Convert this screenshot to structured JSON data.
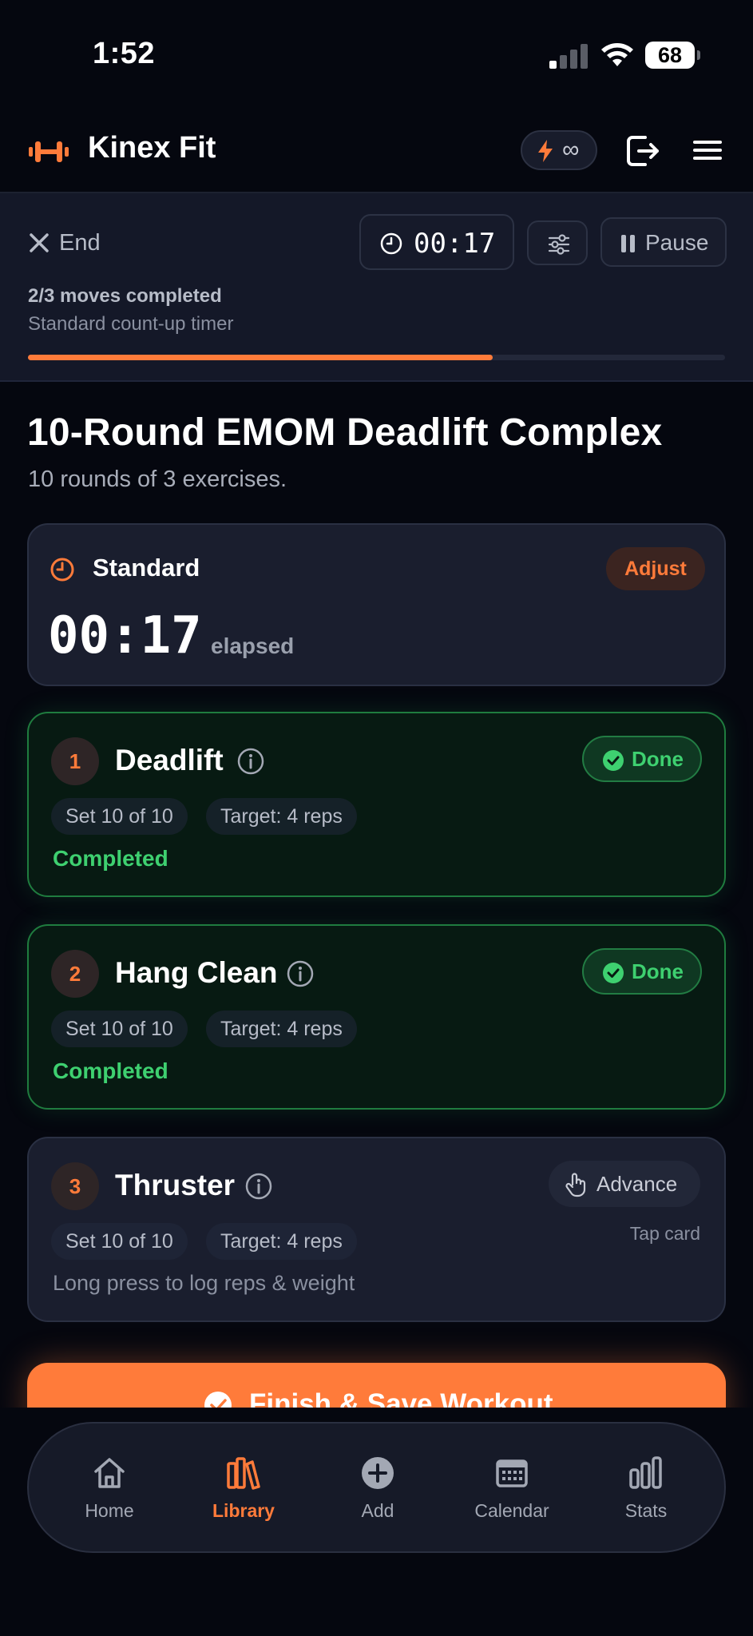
{
  "status_bar": {
    "time": "1:52",
    "battery": "68"
  },
  "header": {
    "app_name": "Kinex Fit",
    "energy": "∞"
  },
  "session": {
    "end_label": "End",
    "timer": "00:17",
    "pause_label": "Pause",
    "progress_text": "2/3 moves completed",
    "timer_mode_text": "Standard count-up timer",
    "progress_fraction": 0.667
  },
  "workout": {
    "title": "10-Round EMOM Deadlift Complex",
    "subtitle": "10 rounds of 3 exercises."
  },
  "timer_card": {
    "mode": "Standard",
    "adjust_label": "Adjust",
    "time": "00:17",
    "elapsed_label": "elapsed"
  },
  "exercises": [
    {
      "number": "1",
      "name": "Deadlift",
      "set": "Set 10 of 10",
      "target": "Target: 4 reps",
      "badge": "Done",
      "status": "Completed"
    },
    {
      "number": "2",
      "name": "Hang Clean",
      "set": "Set 10 of 10",
      "target": "Target: 4 reps",
      "badge": "Done",
      "status": "Completed"
    },
    {
      "number": "3",
      "name": "Thruster",
      "set": "Set 10 of 10",
      "target": "Target: 4 reps",
      "advance_label": "Advance",
      "tap_hint": "Tap card",
      "hint": "Long press to log reps & weight"
    }
  ],
  "finish_label": "Finish & Save Workout",
  "tabs": [
    {
      "label": "Home",
      "icon": "home-icon"
    },
    {
      "label": "Library",
      "icon": "library-icon",
      "active": true
    },
    {
      "label": "Add",
      "icon": "add-icon"
    },
    {
      "label": "Calendar",
      "icon": "calendar-icon"
    },
    {
      "label": "Stats",
      "icon": "stats-icon"
    }
  ],
  "colors": {
    "accent": "#ff7b3a",
    "success": "#3ed070",
    "background": "#05070f",
    "card": "#1a1e2e"
  }
}
